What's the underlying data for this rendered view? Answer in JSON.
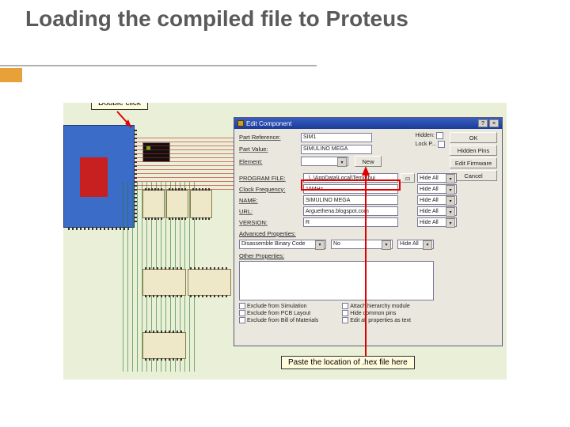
{
  "slide": {
    "title": "Loading the compiled file to Proteus"
  },
  "callouts": {
    "double_click": "Double click",
    "paste_hex": "Paste the location of .hex file here"
  },
  "dialog": {
    "title": "Edit Component",
    "close_help": "?",
    "close_x": "×",
    "fields": {
      "ref_label": "Part Reference:",
      "ref_value": "SIM1",
      "val_label": "Part Value:",
      "val_value": "SIMULINO MEGA",
      "elem_label": "Element:",
      "new_btn": "New",
      "program_file_label": "PROGRAM FILE:",
      "program_file_value": "..\\..\\AppData\\Local\\Temp\\bui",
      "clock_label": "Clock Frequency:",
      "clock_value": "16MHz",
      "name_label": "NAME:",
      "name_value": "SIMULINO MEGA",
      "url_label": "URL:",
      "url_value": "Arguethena.blogspot.com",
      "version_label": "VERSION:",
      "version_value": "R",
      "adv_label": "Advanced Properties:",
      "adv_prop": "Disassemble Binary Code",
      "adv_value": "No",
      "other_label": "Other Properties:"
    },
    "hide_all": "Hide All",
    "top_right": {
      "hidden": "Hidden:",
      "lockp": "Lock P..."
    },
    "buttons": {
      "ok": "OK",
      "hidden_pins": "Hidden Pins",
      "edit_firmware": "Edit Firmware",
      "cancel": "Cancel"
    },
    "checks": {
      "c1": "Exclude from Simulation",
      "c2": "Exclude from PCB Layout",
      "c3": "Exclude from Bill of Materials",
      "c4": "Attach hierarchy module",
      "c5": "Hide common pins",
      "c6": "Edit all properties as text"
    }
  }
}
